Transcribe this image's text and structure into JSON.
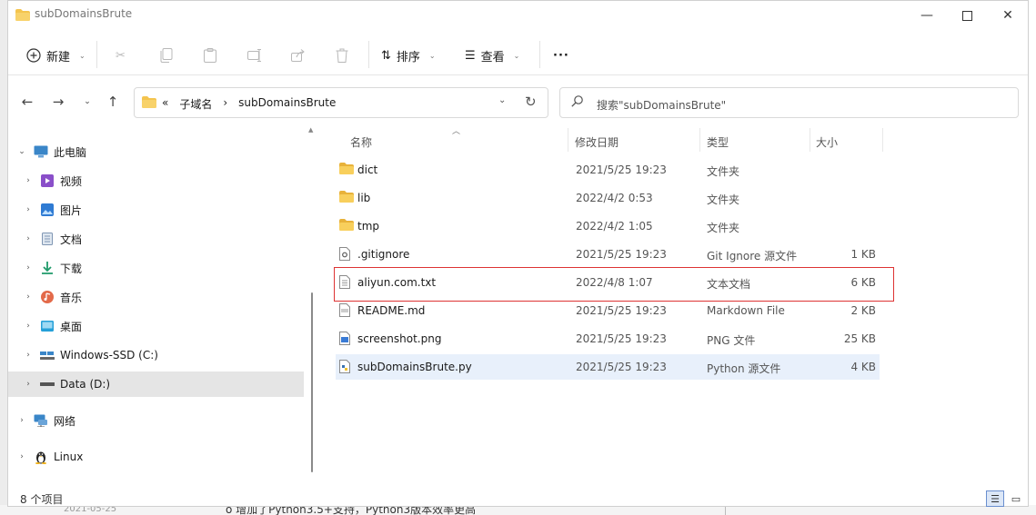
{
  "window": {
    "title": "subDomainsBrute",
    "controls": [
      "minimize-icon",
      "maximize-icon",
      "close-icon"
    ]
  },
  "commandbar": {
    "new_label": "新建",
    "sort_label": "排序",
    "view_label": "查看",
    "more_label": "···"
  },
  "address": {
    "overflow": "«",
    "crumbs": [
      "子域名",
      "subDomainsBrute"
    ],
    "separator": "›"
  },
  "search": {
    "placeholder": "搜索\"subDomainsBrute\""
  },
  "nav": {
    "items": [
      {
        "label": "此电脑",
        "icon": "computer-icon"
      },
      {
        "label": "视频",
        "icon": "video-folder-icon"
      },
      {
        "label": "图片",
        "icon": "pictures-folder-icon"
      },
      {
        "label": "文档",
        "icon": "documents-folder-icon"
      },
      {
        "label": "下载",
        "icon": "download-folder-icon"
      },
      {
        "label": "音乐",
        "icon": "music-folder-icon"
      },
      {
        "label": "桌面",
        "icon": "desktop-folder-icon"
      },
      {
        "label": "Windows-SSD (C:)",
        "icon": "drive-icon"
      },
      {
        "label": "Data (D:)",
        "icon": "drive-icon"
      },
      {
        "label": "网络",
        "icon": "network-icon"
      },
      {
        "label": "Linux",
        "icon": "linux-icon"
      }
    ]
  },
  "files": {
    "columns": [
      "名称",
      "修改日期",
      "类型",
      "大小"
    ],
    "rows": [
      {
        "name": "dict",
        "date": "2021/5/25 19:23",
        "type": "文件夹",
        "size": "",
        "icon": "folder-icon"
      },
      {
        "name": "lib",
        "date": "2022/4/2 0:53",
        "type": "文件夹",
        "size": "",
        "icon": "folder-icon"
      },
      {
        "name": "tmp",
        "date": "2022/4/2 1:05",
        "type": "文件夹",
        "size": "",
        "icon": "folder-icon"
      },
      {
        "name": ".gitignore",
        "date": "2021/5/25 19:23",
        "type": "Git Ignore 源文件",
        "size": "1 KB",
        "icon": "gitignore-file-icon"
      },
      {
        "name": "aliyun.com.txt",
        "date": "2022/4/8 1:07",
        "type": "文本文档",
        "size": "6 KB",
        "icon": "text-file-icon"
      },
      {
        "name": "README.md",
        "date": "2021/5/25 19:23",
        "type": "Markdown File",
        "size": "2 KB",
        "icon": "markdown-file-icon"
      },
      {
        "name": "screenshot.png",
        "date": "2021/5/25 19:23",
        "type": "PNG 文件",
        "size": "25 KB",
        "icon": "image-file-icon"
      },
      {
        "name": "subDomainsBrute.py",
        "date": "2021/5/25 19:23",
        "type": "Python 源文件",
        "size": "4 KB",
        "icon": "python-file-icon"
      }
    ]
  },
  "status": {
    "count": "8 个项目"
  },
  "background": {
    "date_fragment": "2021-05-25",
    "text_fragment": "o  增加了Python3.5+支持，Python3版本效率更高"
  },
  "colors": {
    "folder": "#f4c44e",
    "selected_row": "#e8f0fb",
    "nav_selected": "#e5e5e5",
    "highlight_border": "#dd3333",
    "accent": "#4a7cc9"
  }
}
